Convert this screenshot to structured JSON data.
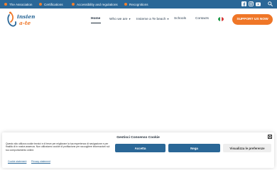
{
  "topbar": {
    "links": [
      {
        "label": "The Association"
      },
      {
        "label": "Certifications"
      },
      {
        "label": "Accessibility and regulations"
      },
      {
        "label": "Recognitions"
      }
    ],
    "social": [
      "facebook-icon",
      "instagram-icon",
      "youtube-icon"
    ]
  },
  "logo": {
    "line1": "insieme",
    "line2": "a-te"
  },
  "nav": {
    "items": [
      {
        "label": "Home"
      },
      {
        "label": "Who we are"
      },
      {
        "label": "Insieme a Te beach"
      },
      {
        "label": "Schools"
      },
      {
        "label": "Contacts"
      }
    ],
    "language_flag": "italian-flag-icon",
    "support_button": "SUPPORT US NOW"
  },
  "colors": {
    "topbar": "#2a6797",
    "accent": "#ef7627",
    "primary_button": "#2a6797"
  },
  "cookie": {
    "title": "Gestisci Consenso Cookie",
    "text": "Questo sito utilizza cookie tecnici e di terze per migliorare la tua esperienza di navigazione e per finalità di in nostra assenza. Non utilizziamo cookie di profilazione per raccogliere informazioni sul tuo comportamento online.",
    "accept": "Accetta",
    "deny": "Nega",
    "preferences": "Visualizza le preferenze",
    "cookie_statement": "Cookie statement",
    "privacy_statement": "Privacy statement"
  }
}
